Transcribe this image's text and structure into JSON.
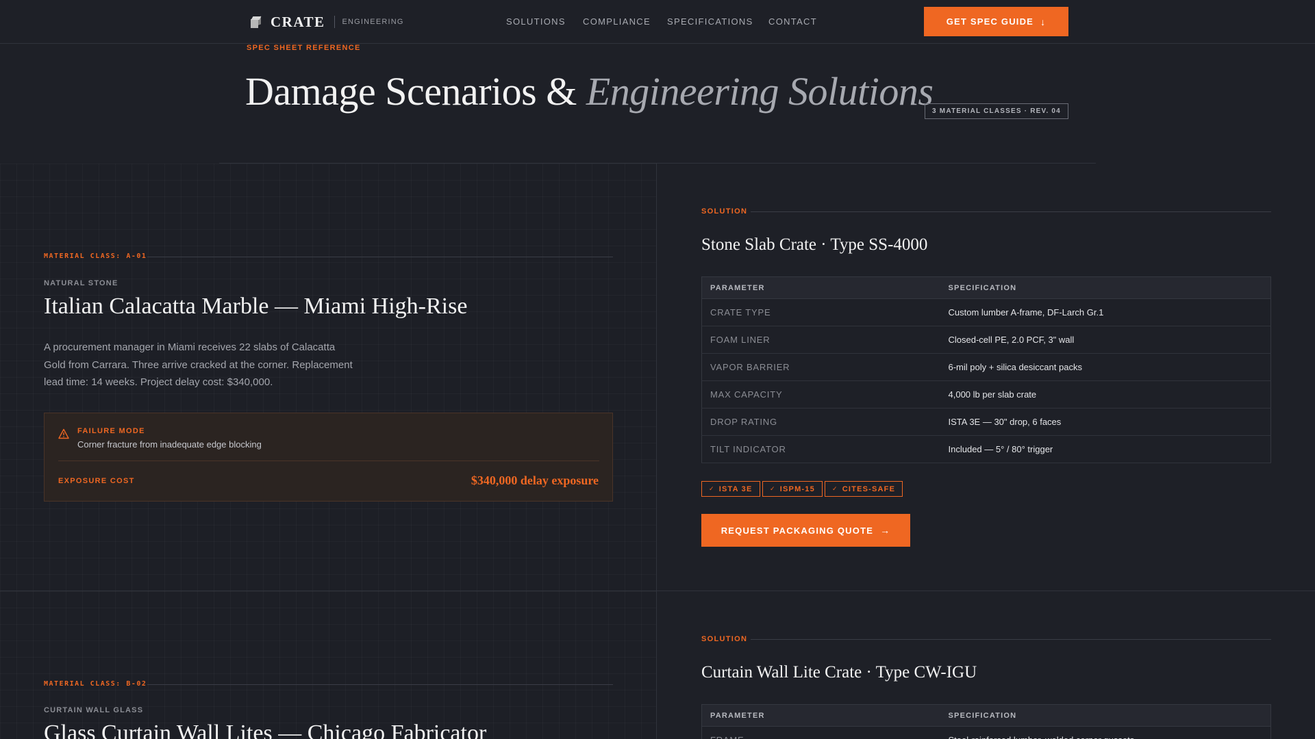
{
  "nav": {
    "brand": "CRATE",
    "brand_sub": "ENGINEERING",
    "links": [
      "SOLUTIONS",
      "COMPLIANCE",
      "SPECIFICATIONS",
      "CONTACT"
    ],
    "cta": "GET SPEC GUIDE",
    "cta_icon": "arrow-down-icon",
    "logo_icon": "crate-cube-icon"
  },
  "hero": {
    "eyebrow": "SPEC SHEET REFERENCE",
    "title_main": "Damage Scenarios & ",
    "title_italic": "Engineering Solutions",
    "badge": "3 MATERIAL CLASSES · REV. 04"
  },
  "colors": {
    "accent": "#ef6722",
    "background": "#1e2027"
  },
  "scenarios": [
    {
      "material_class": "MATERIAL CLASS: A-01",
      "category": "NATURAL STONE",
      "title": "Italian Calacatta Marble — Miami High-Rise",
      "description": "A procurement manager in Miami receives 22 slabs of Calacatta Gold from Carrara. Three arrive cracked at the corner. Replacement lead time: 14 weeks. Project delay cost: $340,000.",
      "failure_mode_label": "FAILURE MODE",
      "failure_mode": "Corner fracture from inadequate edge blocking",
      "exposure_label": "EXPOSURE COST",
      "exposure_value": "$340,000 delay exposure",
      "solution_label": "SOLUTION",
      "solution_title": "Stone Slab Crate · Type SS-4000",
      "table_headers": [
        "PARAMETER",
        "SPECIFICATION"
      ],
      "rows": [
        {
          "param": "CRATE TYPE",
          "spec": "Custom lumber A-frame, DF-Larch Gr.1"
        },
        {
          "param": "FOAM LINER",
          "spec": "Closed-cell PE, 2.0 PCF, 3\" wall"
        },
        {
          "param": "VAPOR BARRIER",
          "spec": "6-mil poly + silica desiccant packs"
        },
        {
          "param": "MAX CAPACITY",
          "spec": "4,000 lb per slab crate"
        },
        {
          "param": "DROP RATING",
          "spec": "ISTA 3E — 30\" drop, 6 faces"
        },
        {
          "param": "TILT INDICATOR",
          "spec": "Included — 5° / 80° trigger"
        }
      ],
      "tags": [
        "ISTA 3E",
        "ISPM-15",
        "CITES-SAFE"
      ],
      "cta": "REQUEST PACKAGING QUOTE"
    },
    {
      "material_class": "MATERIAL CLASS: B-02",
      "category": "CURTAIN WALL GLASS",
      "title": "Glass Curtain Wall Lites — Chicago Fabricator",
      "solution_label": "SOLUTION",
      "solution_title": "Curtain Wall Lite Crate · Type CW-IGU",
      "table_headers": [
        "PARAMETER",
        "SPECIFICATION"
      ],
      "rows": [
        {
          "param": "FRAME",
          "spec": "Steel-reinforced lumber, welded corner gussets"
        }
      ]
    }
  ]
}
